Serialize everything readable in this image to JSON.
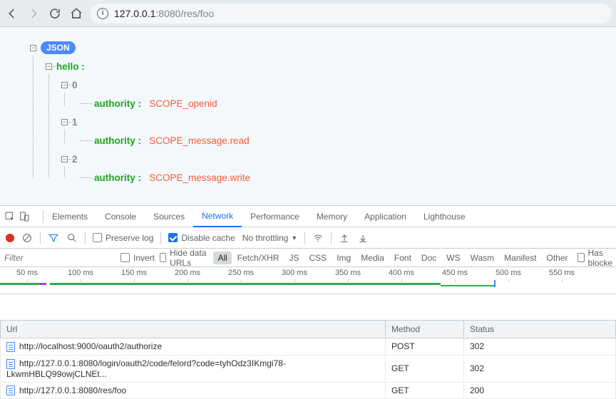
{
  "browser": {
    "url_prefix": "127.0.0.1",
    "url_port": ":8080",
    "url_path": "/res/foo"
  },
  "json_tree": {
    "root_badge": "JSON",
    "hello_key": "hello :",
    "items": [
      {
        "index": "0",
        "key": "authority :",
        "value": "SCOPE_openid"
      },
      {
        "index": "1",
        "key": "authority :",
        "value": "SCOPE_message.read"
      },
      {
        "index": "2",
        "key": "authority :",
        "value": "SCOPE_message.write"
      }
    ]
  },
  "devtools": {
    "tabs": {
      "elements": "Elements",
      "console": "Console",
      "sources": "Sources",
      "network": "Network",
      "performance": "Performance",
      "memory": "Memory",
      "application": "Application",
      "lighthouse": "Lighthouse"
    },
    "toolbar": {
      "preserve_log": "Preserve log",
      "disable_cache": "Disable cache",
      "throttling": "No throttling"
    },
    "filter": {
      "placeholder": "Filter",
      "invert": "Invert",
      "hide_data_urls": "Hide data URLs",
      "chips": [
        "All",
        "Fetch/XHR",
        "JS",
        "CSS",
        "Img",
        "Media",
        "Font",
        "Doc",
        "WS",
        "Wasm",
        "Manifest",
        "Other"
      ],
      "has_blocked": "Has blocke"
    },
    "timeline_ticks": [
      "50 ms",
      "100 ms",
      "150 ms",
      "200 ms",
      "250 ms",
      "300 ms",
      "350 ms",
      "400 ms",
      "450 ms",
      "500 ms",
      "550 ms"
    ],
    "network_table": {
      "headers": {
        "url": "Url",
        "method": "Method",
        "status": "Status"
      },
      "rows": [
        {
          "url": "http://localhost:9000/oauth2/authorize",
          "method": "POST",
          "status": "302"
        },
        {
          "url": "http://127.0.0.1:8080/login/oauth2/code/felord?code=tyhOdz3IKmgi78-LkwmHBLQ99owjCLNEt...",
          "method": "GET",
          "status": "302"
        },
        {
          "url": "http://127.0.0.1:8080/res/foo",
          "method": "GET",
          "status": "200"
        }
      ]
    }
  }
}
